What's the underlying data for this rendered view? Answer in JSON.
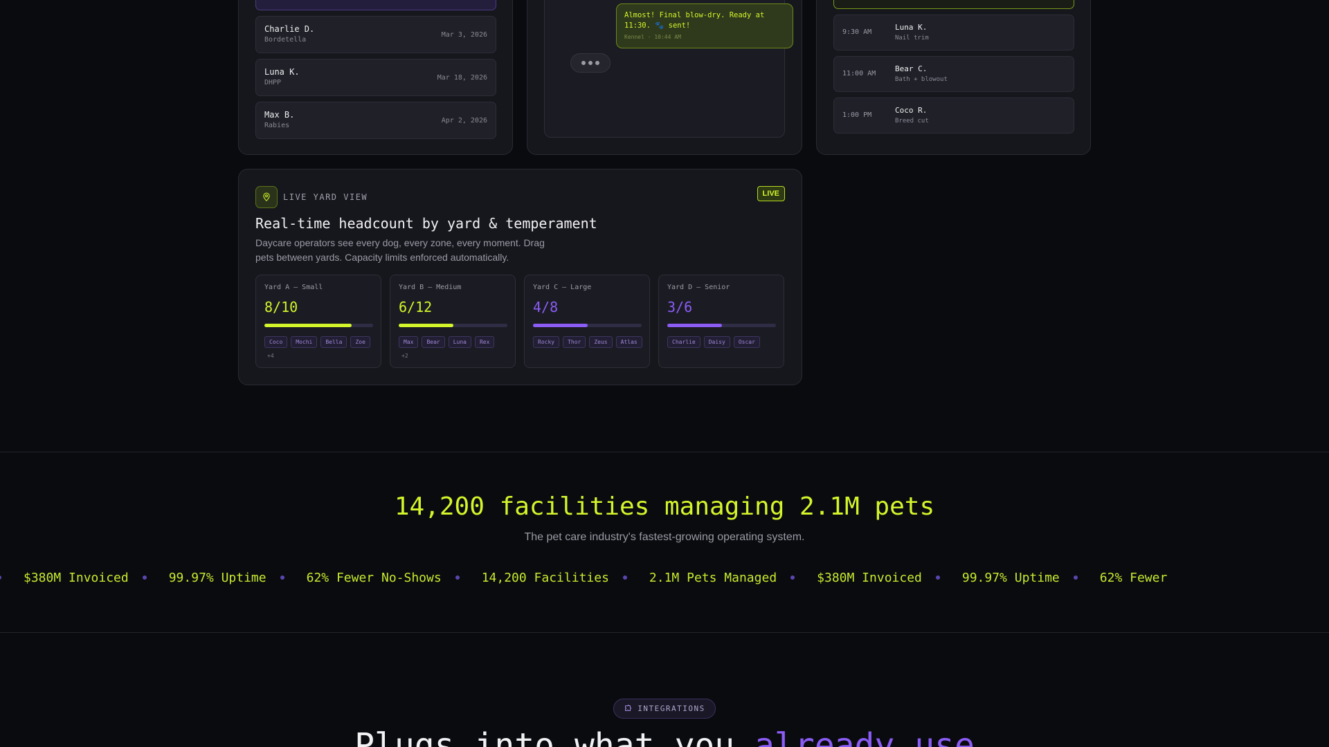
{
  "vaccinations": {
    "rows": [
      {
        "name": "Charlie D.",
        "vaccine": "Bordetella",
        "date": "Mar 3, 2026"
      },
      {
        "name": "Luna K.",
        "vaccine": "DHPP",
        "date": "Mar 18, 2026"
      },
      {
        "name": "Max B.",
        "vaccine": "Rabies",
        "date": "Apr 2, 2026"
      }
    ]
  },
  "chat": {
    "message": "Almost! Final blow-dry. Ready at 11:30. 🐾 sent!",
    "meta": "Kennel · 10:44 AM"
  },
  "schedule": {
    "rows": [
      {
        "time": "9:30 AM",
        "name": "Luna K.",
        "service": "Nail trim"
      },
      {
        "time": "11:00 AM",
        "name": "Bear C.",
        "service": "Bath + blowout"
      },
      {
        "time": "1:00 PM",
        "name": "Coco R.",
        "service": "Breed cut"
      }
    ]
  },
  "yard": {
    "label": "LIVE YARD VIEW",
    "badge": "LIVE",
    "title": "Real-time headcount by yard & temperament",
    "description": "Daycare operators see every dog, every zone, every moment. Drag pets between yards. Capacity limits enforced automatically.",
    "yards": [
      {
        "name": "Yard A — Small",
        "count": "8/10",
        "fill": 0.8,
        "color": "#d4f52b",
        "tags": [
          "Coco",
          "Mochi",
          "Bella",
          "Zoe"
        ],
        "more": "+4"
      },
      {
        "name": "Yard B — Medium",
        "count": "6/12",
        "fill": 0.5,
        "color": "#d4f52b",
        "tags": [
          "Max",
          "Bear",
          "Luna",
          "Rex"
        ],
        "more": "+2"
      },
      {
        "name": "Yard C — Large",
        "count": "4/8",
        "fill": 0.5,
        "color": "#8b5cf6",
        "tags": [
          "Rocky",
          "Thor",
          "Zeus",
          "Atlas"
        ],
        "more": ""
      },
      {
        "name": "Yard D — Senior",
        "count": "3/6",
        "fill": 0.5,
        "color": "#8b5cf6",
        "tags": [
          "Charlie",
          "Daisy",
          "Oscar"
        ],
        "more": ""
      }
    ]
  },
  "stats": {
    "title": "14,200 facilities managing 2.1M pets",
    "subtitle": "The pet care industry's fastest-growing operating system.",
    "ticker": [
      "$380M Invoiced",
      "99.97% Uptime",
      "62% Fewer No-Shows",
      "14,200 Facilities",
      "2.1M Pets Managed",
      "$380M Invoiced",
      "99.97% Uptime",
      "62% Fewer"
    ]
  },
  "integrations": {
    "pill": "INTEGRATIONS",
    "title_plain": "Plugs into what you ",
    "title_accent": "already use"
  },
  "colors": {
    "lime": "#d4f52b",
    "violet": "#8b5cf6",
    "background": "#0a0b0f"
  }
}
